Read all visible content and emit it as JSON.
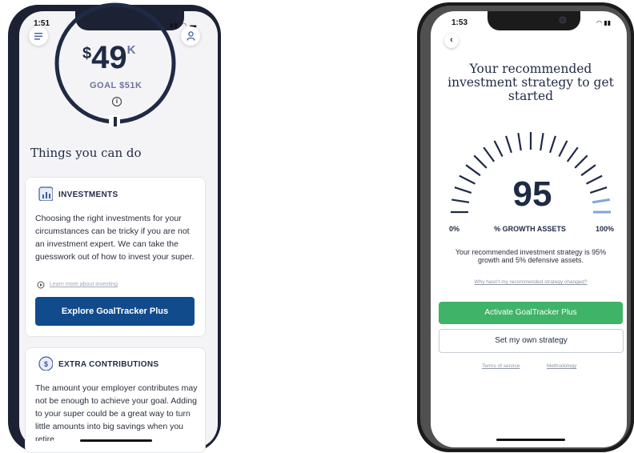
{
  "phone1": {
    "status_time": "1:51",
    "status_icons": "▮▮ ◠ ▬",
    "goal_amount": {
      "currency": "$",
      "value": "49",
      "unit": "K"
    },
    "goal_label": "GOAL $51K",
    "info_glyph": "i",
    "things_heading": "Things you can do",
    "investments_card": {
      "title": "INVESTMENTS",
      "body": "Choosing the right investments for your circumstances can be tricky if you are not an investment expert. We can take the guesswork out of how to invest your super.",
      "learn_link": "Learn more about investing",
      "button_label": "Explore GoalTracker Plus"
    },
    "contributions_card": {
      "title": "EXTRA CONTRIBUTIONS",
      "body": "The amount your employer contributes may not be enough to achieve your goal. Adding to your super could be a great way to turn little amounts into big savings when you retire"
    },
    "colors": {
      "navy": "#1f2a44",
      "button_blue": "#124b8c"
    }
  },
  "phone2": {
    "status_time": "1:53",
    "status_icons": "◠ ▮▮",
    "back_glyph": "‹",
    "title": "Your recommended investment strategy to get started",
    "gauge": {
      "value": "95",
      "percent": 95,
      "min_label": "0%",
      "max_label": "100%",
      "caption": "% GROWTH ASSETS"
    },
    "description": "Your recommended investment strategy is 95% growth and 5% defensive assets.",
    "why_link": "Why hasn't my recommended strategy changed?",
    "activate_label": "Activate GoalTracker Plus",
    "own_strategy_label": "Set my own strategy",
    "terms_link": "Terms of service",
    "methodology_link": "Methodology",
    "colors": {
      "green": "#3fb367",
      "gauge_highlight": "#7fa6d6"
    }
  }
}
